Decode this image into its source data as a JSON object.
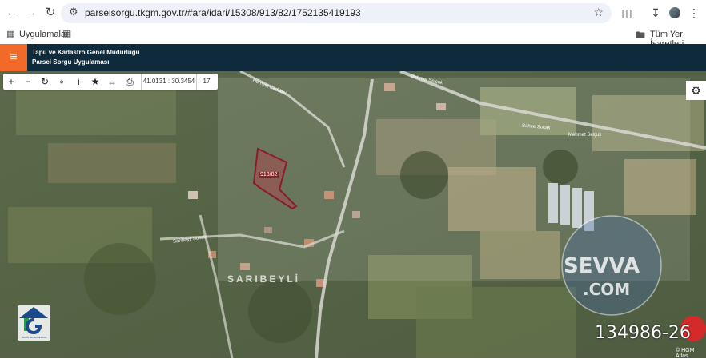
{
  "browser": {
    "url": "parselsorgu.tkgm.gov.tr/#ara/idari/15308/913/82/1752135419193",
    "bookmarks": {
      "apps_label": "Uygulamalar",
      "all_bookmarks": "Tüm Yer İşaretleri"
    }
  },
  "app": {
    "title_line1": "Tapu ve Kadastro Genel Müdürlüğü",
    "title_line2": "Parsel Sorgu Uygulaması"
  },
  "toolbar": {
    "coordinates": "41.0131 : 30.3454",
    "zoom_level": "17"
  },
  "map": {
    "parcel_label": "913/82",
    "village_name": "SARIBEYLİ",
    "road_labels": [
      "Mehmet Selçuk",
      "Bahçe Sokak",
      "Mehmet Selçuk",
      "Hürriyet Caddesi",
      "Sarıbeyli Sokak"
    ],
    "attribution": "© HGM Atlas",
    "watermark_line1": "SEVVA",
    "watermark_line2": ".COM",
    "listing_number": "134986-26",
    "logo_caption": "TÜZÜN GAYRİMENKUL"
  },
  "icons": [
    "back-icon",
    "forward-icon",
    "reload-icon",
    "tune-icon",
    "star-icon",
    "extensions-icon",
    "download-icon",
    "menu-icon",
    "apps-icon",
    "grid-icon",
    "folder-icon",
    "hamburger-icon",
    "zoom-in-icon",
    "zoom-out-icon",
    "refresh-icon",
    "locate-icon",
    "info-icon",
    "favorite-icon",
    "measure-icon",
    "print-icon",
    "settings-icon"
  ],
  "colors": {
    "header_bg": "#0e2a3b",
    "accent": "#f26a2a",
    "parcel_stroke": "#8b1a2b"
  }
}
